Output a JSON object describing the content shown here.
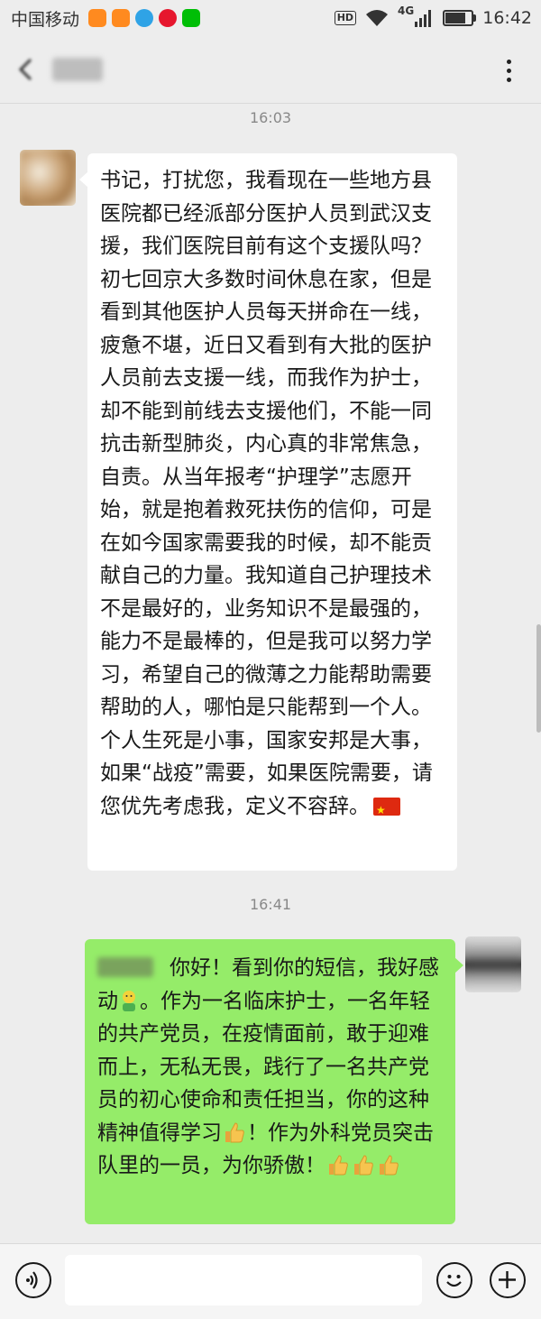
{
  "status_bar": {
    "carrier": "中国移动",
    "network": "4G",
    "hd": "HD",
    "time": "16:42",
    "battery_level": 0.85,
    "app_icons": [
      {
        "name": "taobao-icon",
        "color": "#ff8a1f"
      },
      {
        "name": "taobao-icon",
        "color": "#ff8a1f"
      },
      {
        "name": "browser-icon",
        "color": "#2fa3e6"
      },
      {
        "name": "weibo-icon",
        "color": "#e6162d"
      },
      {
        "name": "iqiyi-icon",
        "color": "#00be06"
      }
    ]
  },
  "header": {
    "title": ""
  },
  "chat": {
    "timestamps": [
      "16:03",
      "16:41"
    ],
    "messages": [
      {
        "side": "left",
        "text": "书记，打扰您，我看现在一些地方县医院都已经派部分医护人员到武汉支援，我们医院目前有这个支援队吗？初七回京大多数时间休息在家，但是看到其他医护人员每天拼命在一线，疲惫不堪，近日又看到有大批的医护人员前去支援一线，而我作为护士，却不能到前线去支援他们，不能一同抗击新型肺炎，内心真的非常焦急，自责。从当年报考“护理学”志愿开始，就是抱着救死扶伤的信仰，可是在如今国家需要我的时候，却不能贡献自己的力量。我知道自己护理技术不是最好的，业务知识不是最强的，能力不是最棒的，但是我可以努力学习，希望自己的微薄之力能帮助需要帮助的人，哪怕是只能帮到一个人。个人生死是小事，国家安邦是大事，如果“战疫”需要，如果医院需要，请您优先考虑我，定义不容辞。",
        "emoji": "china-flag"
      },
      {
        "side": "right",
        "greeting": "你好！看到你的短信，我好感动",
        "part2": "。作为一名临床护士，一名年轻的共产党员，在疫情面前，敢于迎难而上，无私无畏，践行了一名共产党员的初心使命和责任担当，你的这种精神值得学习",
        "part3": "！作为外科党员突击队里的一员，为你骄傲！",
        "emojis": [
          "face-emoji",
          "thumbs-up",
          "thumbs-up",
          "thumbs-up",
          "thumbs-up"
        ]
      }
    ]
  },
  "input_bar": {
    "value": "",
    "placeholder": ""
  },
  "colors": {
    "background": "#ededed",
    "bubble_left": "#ffffff",
    "bubble_right": "#95ec69"
  }
}
